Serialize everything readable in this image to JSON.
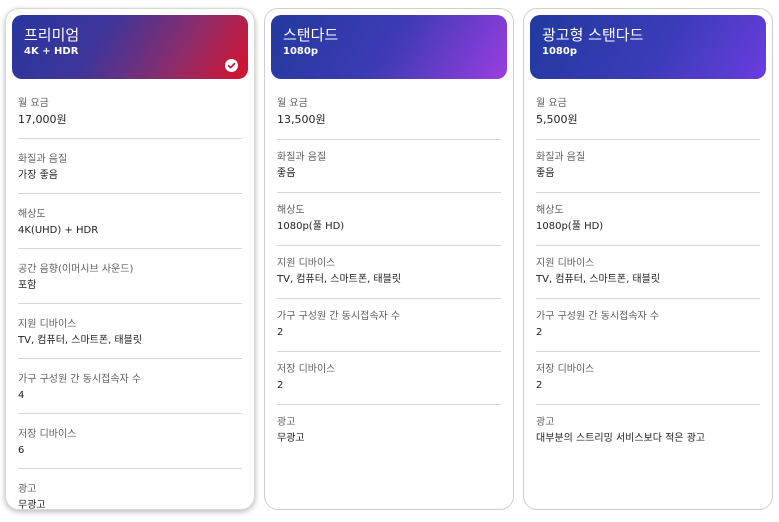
{
  "plans": [
    {
      "name": "프리미엄",
      "quality": "4K + HDR",
      "selected": true,
      "features": [
        {
          "label": "월 요금",
          "value": "17,000원"
        },
        {
          "label": "화질과 음질",
          "value": "가장 좋음"
        },
        {
          "label": "해상도",
          "value": "4K(UHD) + HDR"
        },
        {
          "label": "공간 음향(이머시브 사운드)",
          "value": "포함"
        },
        {
          "label": "지원 디바이스",
          "value": "TV, 컴퓨터, 스마트폰, 태블릿"
        },
        {
          "label": "가구 구성원 간 동시접속자 수",
          "value": "4"
        },
        {
          "label": "저장 디바이스",
          "value": "6"
        },
        {
          "label": "광고",
          "value": "무광고"
        }
      ]
    },
    {
      "name": "스탠다드",
      "quality": "1080p",
      "selected": false,
      "features": [
        {
          "label": "월 요금",
          "value": "13,500원"
        },
        {
          "label": "화질과 음질",
          "value": "좋음"
        },
        {
          "label": "해상도",
          "value": "1080p(풀 HD)"
        },
        {
          "label": "지원 디바이스",
          "value": "TV, 컴퓨터, 스마트폰, 태블릿"
        },
        {
          "label": "가구 구성원 간 동시접속자 수",
          "value": "2"
        },
        {
          "label": "저장 디바이스",
          "value": "2"
        },
        {
          "label": "광고",
          "value": "무광고"
        }
      ]
    },
    {
      "name": "광고형 스탠다드",
      "quality": "1080p",
      "selected": false,
      "features": [
        {
          "label": "월 요금",
          "value": "5,500원"
        },
        {
          "label": "화질과 음질",
          "value": "좋음"
        },
        {
          "label": "해상도",
          "value": "1080p(풀 HD)"
        },
        {
          "label": "지원 디바이스",
          "value": "TV, 컴퓨터, 스마트폰, 태블릿"
        },
        {
          "label": "가구 구성원 간 동시접속자 수",
          "value": "2"
        },
        {
          "label": "저장 디바이스",
          "value": "2"
        },
        {
          "label": "광고",
          "value": "대부분의 스트리밍 서비스보다 적은 광고"
        }
      ]
    }
  ],
  "icons": {
    "selected_check": "check-circle-icon"
  },
  "colors": {
    "premium_gradient_end": "#d8112a",
    "standard_gradient_end": "#9a3ee0",
    "ad_standard_gradient_end": "#6a3ddf",
    "header_start": "#213a9e"
  }
}
